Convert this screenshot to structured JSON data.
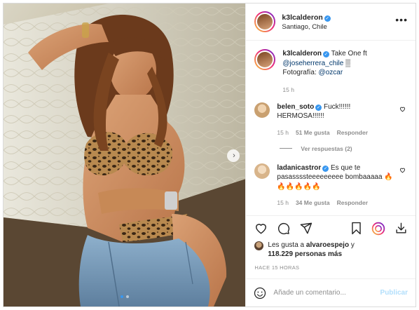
{
  "post": {
    "author": {
      "username": "k3lcalderon",
      "verified": true,
      "location": "Santiago, Chile"
    },
    "caption": {
      "username": "k3lcalderon",
      "text": "Take One ft",
      "mention": "@joseherrera_chile",
      "symbol": "▒",
      "photo_credit_label": "Fotografía:",
      "photo_credit_mention": "@ozcar",
      "age": "15 h"
    },
    "comments": [
      {
        "username": "belen_soto",
        "verified": true,
        "text": "Fuck!!!!!! HERMOSA!!!!!!",
        "age": "15 h",
        "likes": "51 Me gusta",
        "reply_label": "Responder",
        "view_replies": "Ver respuestas (2)"
      },
      {
        "username": "ladanicastror",
        "verified": true,
        "text": "Es que te pasassssteeeeeeeee bombaaaaa 🔥🔥🔥🔥🔥🔥",
        "age": "15 h",
        "likes": "34 Me gusta",
        "reply_label": "Responder"
      }
    ],
    "likes_summary": {
      "prefix": "Les gusta a",
      "user": "alvaroespejo",
      "joiner": "y",
      "count": "118.229 personas más"
    },
    "timestamp": "HACE 15 HORAS",
    "add_comment_placeholder": "Añade un comentario...",
    "publish_label": "Publicar",
    "carousel": {
      "count": 2,
      "active": 1
    }
  },
  "icons": {
    "more": "more-options-icon",
    "like": "heart-icon",
    "comment": "comment-icon",
    "share": "share-icon",
    "save": "bookmark-icon",
    "emoji": "emoji-icon"
  },
  "colors": {
    "verified": "#3897f0",
    "link": "#00376b",
    "muted": "#8e8e8e",
    "publish_disabled": "#b2dffc"
  }
}
